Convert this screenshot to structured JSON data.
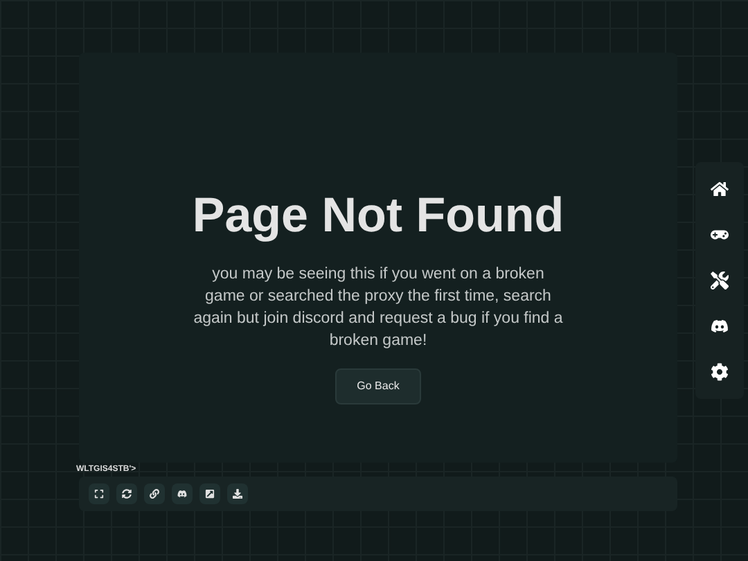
{
  "heading": "Page Not Found",
  "message": "you may be seeing this if you went on a broken game or searched the proxy the first time, search again but join discord and request a bug if you find a broken game!",
  "button": "Go Back",
  "frame_label": "WLTGIS4STB'>",
  "toolbar": [
    {
      "kind": "fullscreen"
    },
    {
      "kind": "reload"
    },
    {
      "kind": "link"
    },
    {
      "kind": "discord"
    },
    {
      "kind": "external"
    },
    {
      "kind": "download"
    }
  ],
  "sidebar": [
    {
      "kind": "home"
    },
    {
      "kind": "games"
    },
    {
      "kind": "tools"
    },
    {
      "kind": "discord"
    },
    {
      "kind": "settings"
    }
  ]
}
